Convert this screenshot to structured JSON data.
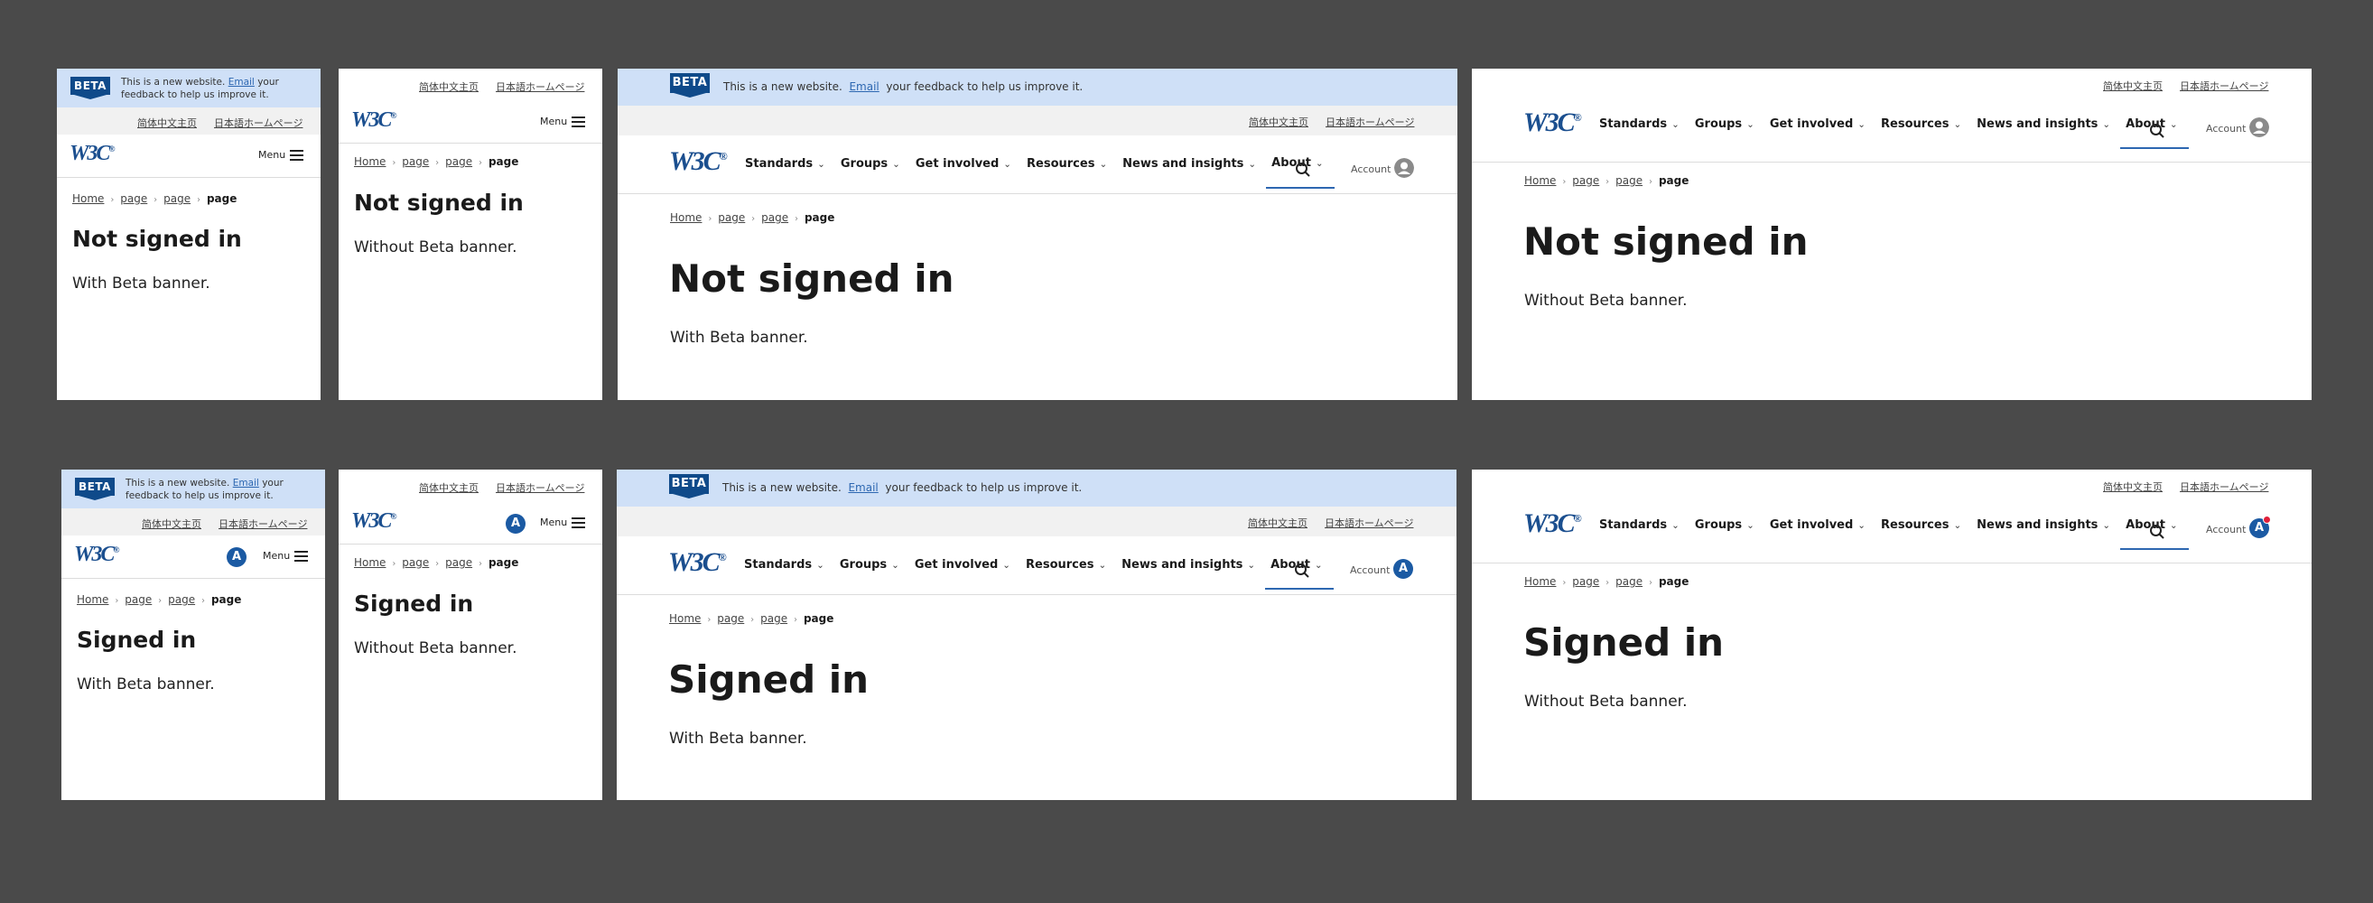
{
  "beta": {
    "badge": "BETA",
    "text_before": "This is a new website.",
    "link": "Email",
    "text_after": "your feedback to help us improve it.",
    "mobile_line1_before": "This is a new website.",
    "mobile_line1_after": "your",
    "mobile_line2": "feedback to help us improve it."
  },
  "lang": {
    "zh": "简体中文主页",
    "ja": "日本語ホームページ"
  },
  "header": {
    "logo": "W3C",
    "menu_label": "Menu",
    "account_label": "Account",
    "avatar_letter": "A"
  },
  "nav": {
    "items": [
      {
        "label": "Standards"
      },
      {
        "label": "Groups"
      },
      {
        "label": "Get involved"
      },
      {
        "label": "Resources"
      },
      {
        "label": "News and insights"
      },
      {
        "label": "About",
        "active": true
      }
    ],
    "chevron": "⌄"
  },
  "breadcrumb": {
    "home": "Home",
    "page": "page",
    "current": "page",
    "separator": "›"
  },
  "variants": {
    "not_signed_in": {
      "title": "Not signed in"
    },
    "signed_in": {
      "title": "Signed in"
    },
    "with_beta": "With Beta banner.",
    "without_beta": "Without Beta banner."
  },
  "colors": {
    "background": "#4a4a4a",
    "beta_bar": "#cfe0f7",
    "beta_badge": "#0f4a8a",
    "link": "#2d67b1",
    "avatar": "#1b5aa3",
    "notification_dot": "#e0203a"
  }
}
